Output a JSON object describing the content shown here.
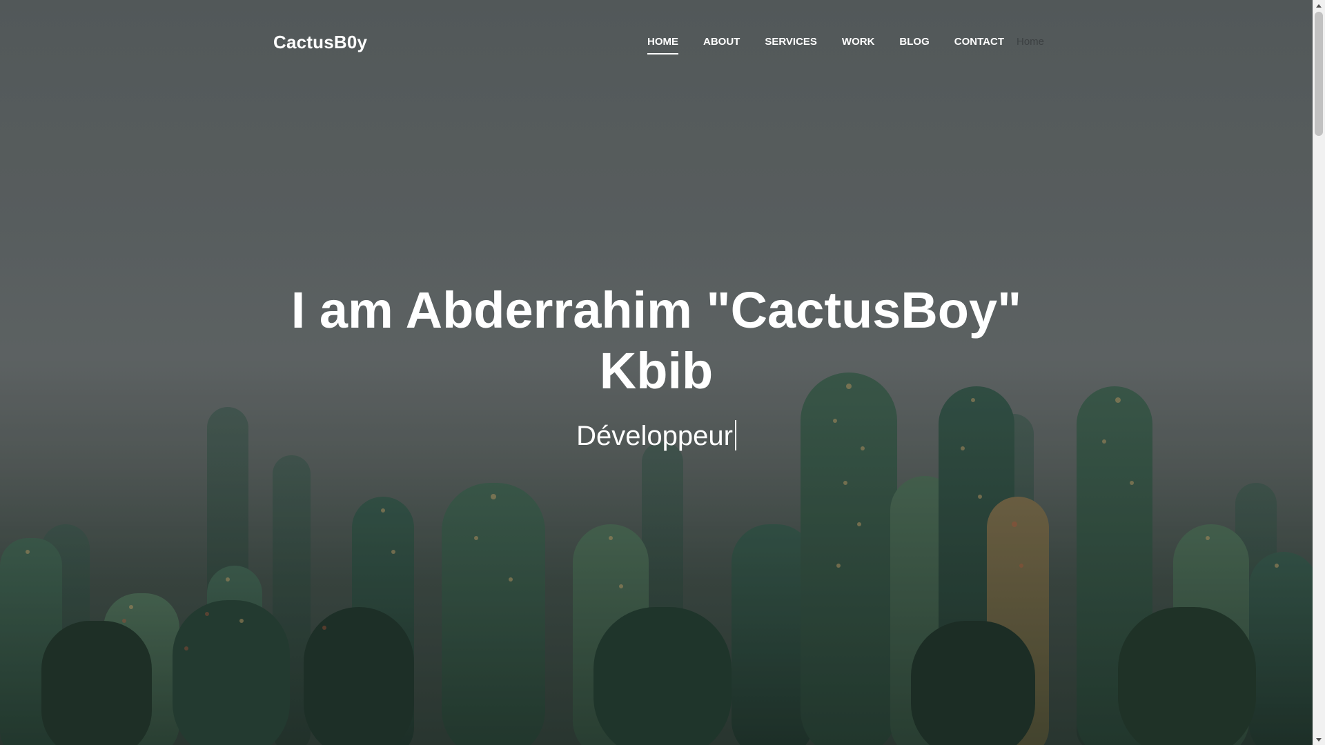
{
  "navbar": {
    "brand": "CactusB0y",
    "links": [
      {
        "label": "HOME",
        "active": true
      },
      {
        "label": "ABOUT",
        "active": false
      },
      {
        "label": "SERVICES",
        "active": false
      },
      {
        "label": "WORK",
        "active": false
      },
      {
        "label": "BLOG",
        "active": false
      },
      {
        "label": "CONTACT",
        "active": false
      }
    ],
    "current_page": "Home"
  },
  "hero": {
    "title_line1": "I am Abderrahim \"CactusBoy\"",
    "title_line2": "Kbib",
    "subtitle": "Développeur",
    "background_icon": "cactus-photo"
  },
  "colors": {
    "text": "#ffffff",
    "sky_top": "#5f6566",
    "cactus_green": "#2f4a3a",
    "scrollbar_track": "#f1f1f1",
    "scrollbar_thumb": "#c1c1c1"
  },
  "scroll": {
    "position_fraction": 0
  }
}
